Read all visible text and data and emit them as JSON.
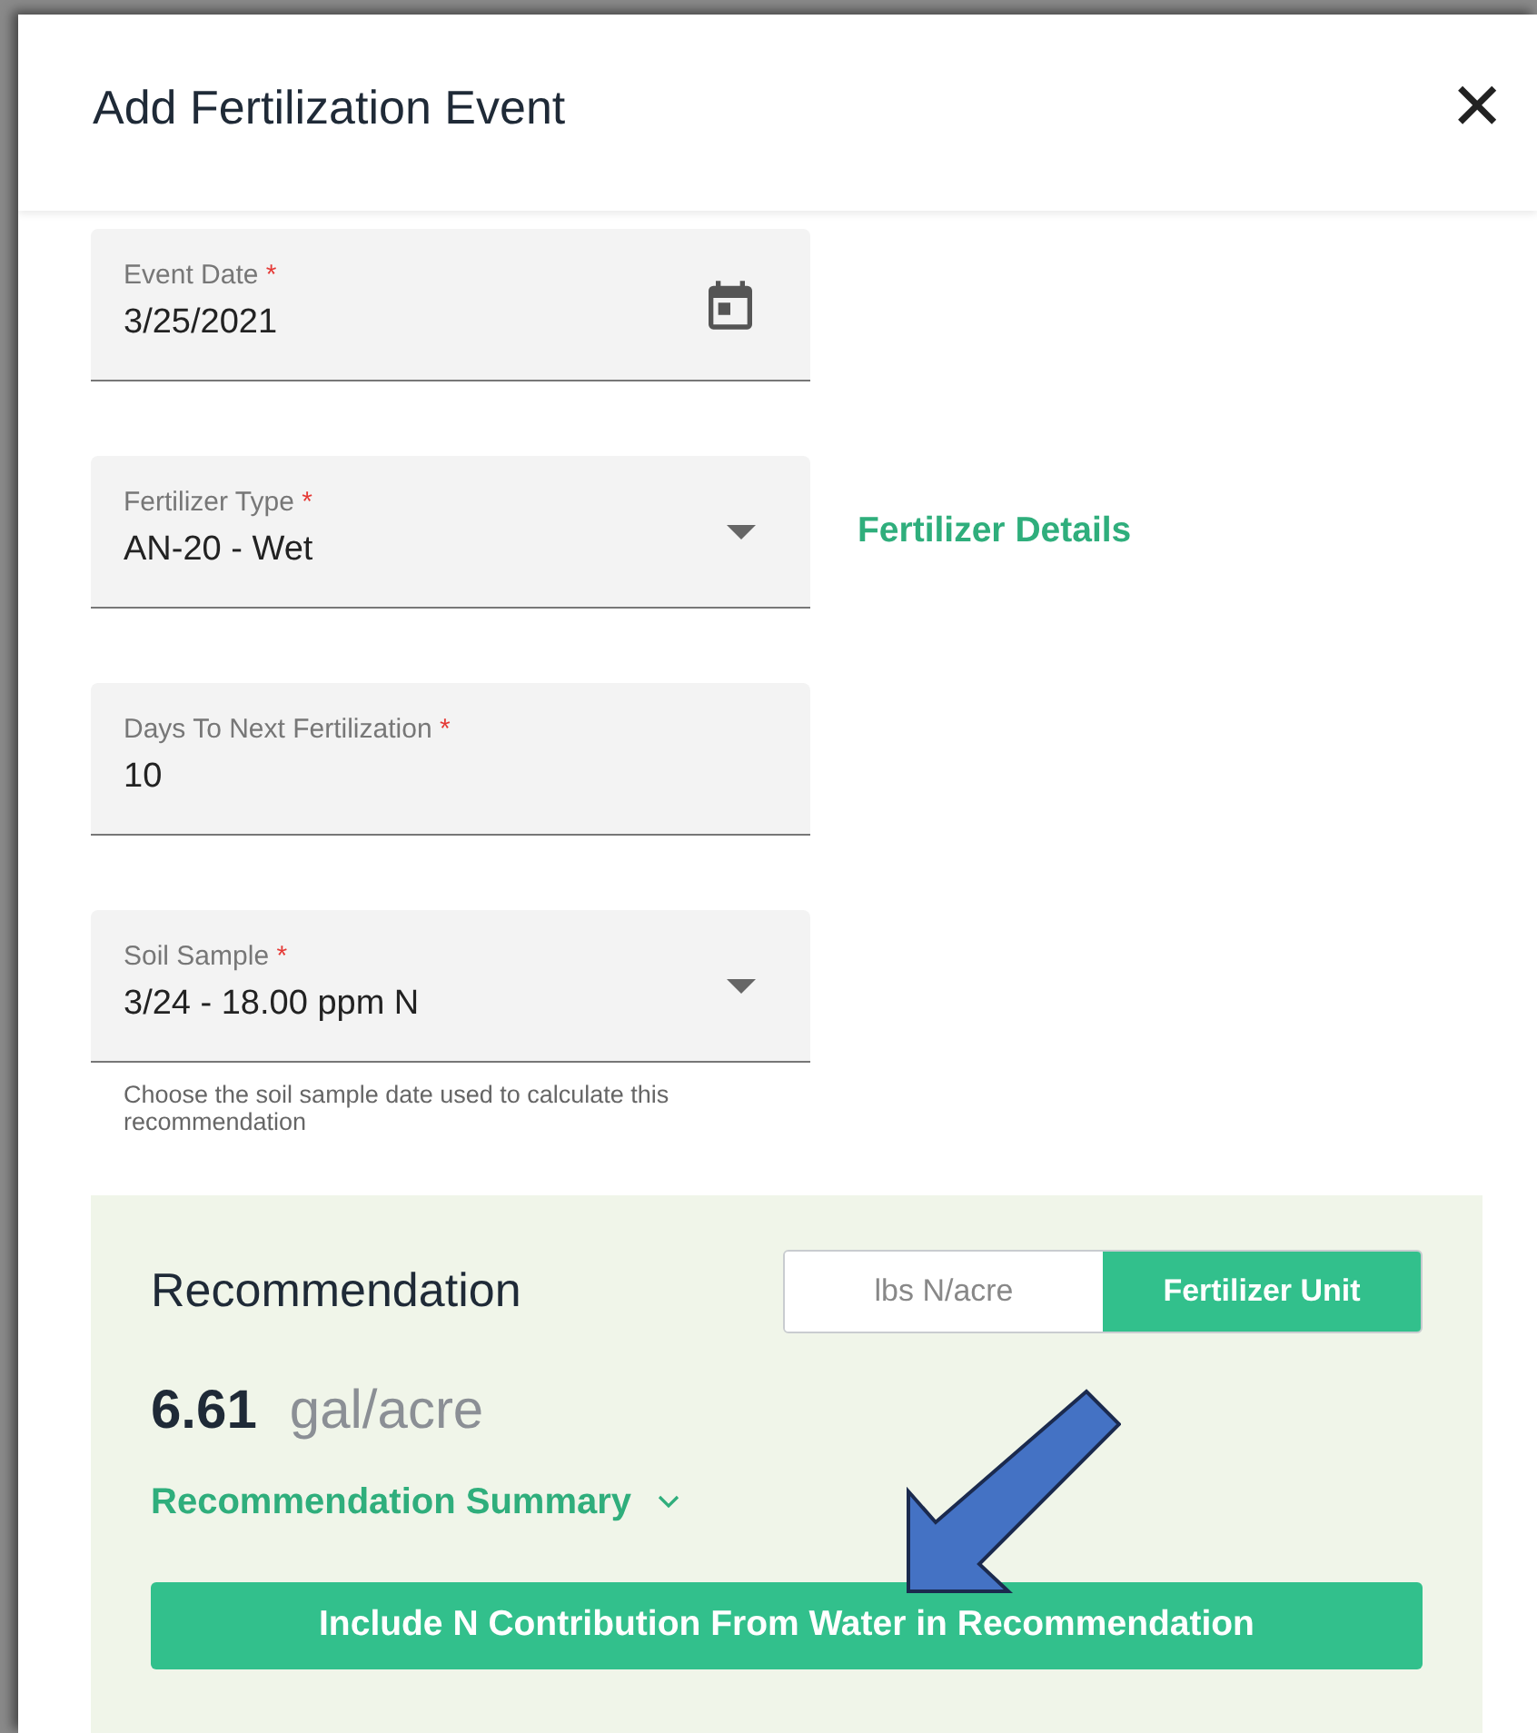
{
  "dialog": {
    "title": "Add Fertilization Event",
    "close": "✕"
  },
  "fields": [
    {
      "kind": "date",
      "label": "Event Date",
      "required_mark": "*",
      "value": "3/25/2021"
    },
    {
      "kind": "select",
      "label": "Fertilizer Type",
      "required_mark": "*",
      "value": "AN-20 - Wet",
      "link": "Fertilizer Details"
    },
    {
      "kind": "text",
      "label": "Days To Next Fertilization",
      "required_mark": "*",
      "value": "10"
    },
    {
      "kind": "select",
      "label": "Soil Sample",
      "required_mark": "*",
      "value": "3/24 - 18.00 ppm N",
      "hint": "Choose the soil sample date used to calculate this recommendation"
    }
  ],
  "recommendation": {
    "title": "Recommendation",
    "units": [
      {
        "label": "lbs N/acre",
        "selected": false
      },
      {
        "label": "Fertilizer Unit",
        "selected": true
      }
    ],
    "amount": "6.61",
    "unit": "gal/acre",
    "summary": "Recommendation Summary",
    "expanded": false,
    "button": "Include N Contribution From Water in Recommendation"
  }
}
